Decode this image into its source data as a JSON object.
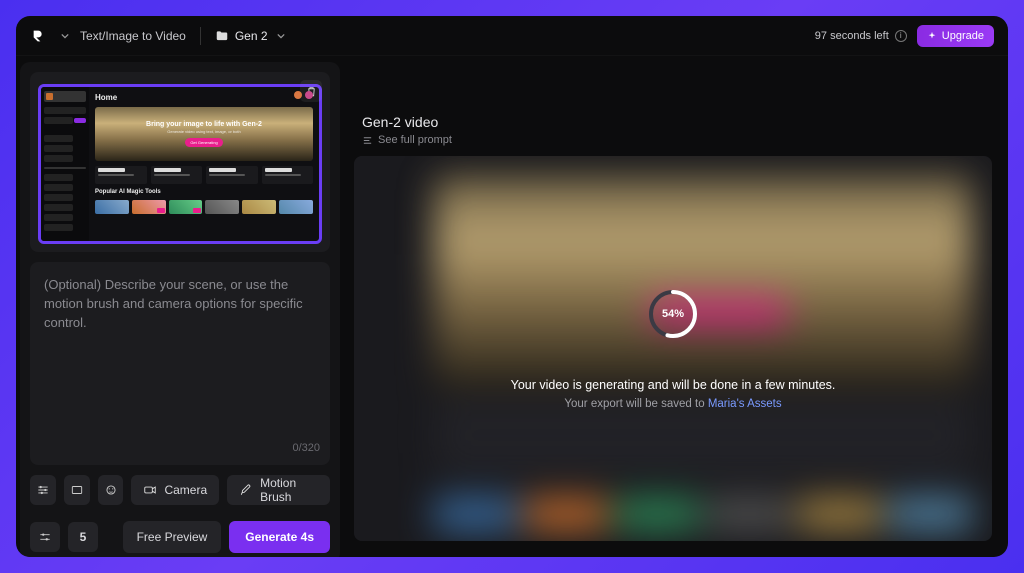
{
  "topbar": {
    "tool_name": "Text/Image to Video",
    "folder_name": "Gen 2",
    "seconds_left": "97 seconds left",
    "upgrade_label": "Upgrade"
  },
  "thumb": {
    "home_label": "Home",
    "hero_title": "Bring your image to life with Gen-2",
    "hero_subtitle": "Generate video using text, image, or both",
    "hero_button": "Get Generating",
    "cards": [
      {
        "title": "Your Assets"
      },
      {
        "title": "Try Gen-1"
      },
      {
        "title": "Text Editing"
      },
      {
        "title": "Introduce Yourself"
      }
    ],
    "popular_label": "Popular AI Magic Tools"
  },
  "prompt": {
    "placeholder": "(Optional) Describe your scene, or use the motion brush and camera options for specific control.",
    "char_count": "0/320"
  },
  "options": {
    "camera_label": "Camera",
    "motion_brush_label": "Motion Brush"
  },
  "bottom": {
    "seed_value": "5",
    "free_preview": "Free Preview",
    "generate": "Generate 4s"
  },
  "preview": {
    "title": "Gen-2 video",
    "full_prompt_label": "See full prompt",
    "progress_pct": 54,
    "progress_label": "54%",
    "generating_line": "Your video is generating and will be done in a few minutes.",
    "save_prefix": "Your export will be saved to ",
    "save_link": "Maria's Assets"
  },
  "colors": {
    "accent": "#7a2ff0",
    "pink": "#e91e8c"
  }
}
